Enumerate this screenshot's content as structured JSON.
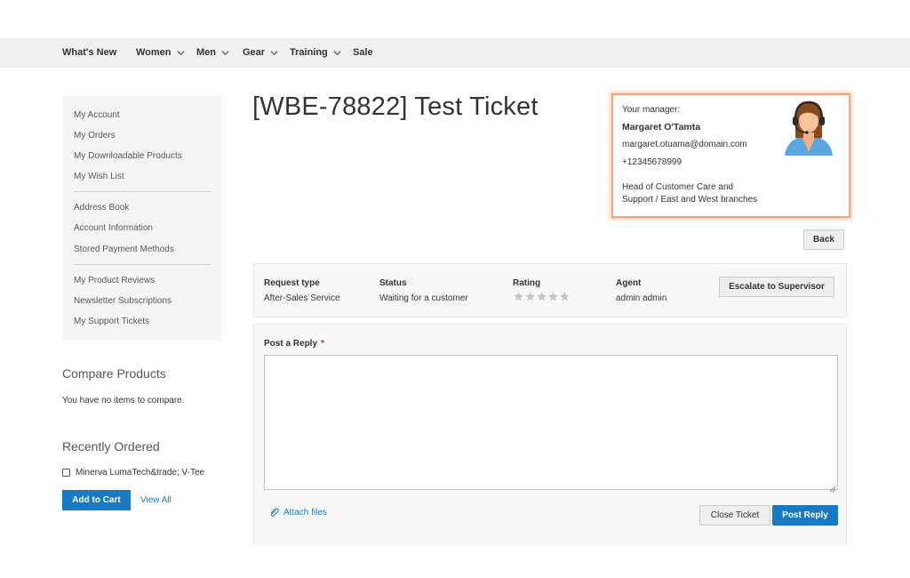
{
  "nav": {
    "items": [
      {
        "label": "What's New",
        "has_menu": false
      },
      {
        "label": "Women",
        "has_menu": true
      },
      {
        "label": "Men",
        "has_menu": true
      },
      {
        "label": "Gear",
        "has_menu": true
      },
      {
        "label": "Training",
        "has_menu": true
      },
      {
        "label": "Sale",
        "has_menu": false
      }
    ]
  },
  "sidebar": {
    "group1": [
      "My Account",
      "My Orders",
      "My Downloadable Products",
      "My Wish List"
    ],
    "group2": [
      "Address Book",
      "Account Information",
      "Stored Payment Methods"
    ],
    "group3": [
      "My Product Reviews",
      "Newsletter Subscriptions",
      "My Support Tickets"
    ]
  },
  "compare": {
    "title": "Compare Products",
    "empty_text": "You have no items to compare."
  },
  "recent": {
    "title": "Recently Ordered",
    "item": "Minerva LumaTech&trade; V-Tee",
    "add_to_cart": "Add to Cart",
    "view_all": "View All"
  },
  "ticket": {
    "title": "[WBE-78822] Test Ticket",
    "back_label": "Back",
    "request_type_label": "Request type",
    "request_type_value": "After-Sales Service",
    "status_label": "Status",
    "status_value": "Waiting for a customer",
    "rating_label": "Rating",
    "rating_value": 0,
    "rating_max": 5,
    "agent_label": "Agent",
    "agent_value": "admin admin",
    "escalate_label": "Escalate to Supervisor"
  },
  "manager": {
    "heading": "Your manager:",
    "name": "Margaret O'Tamta",
    "email": "margaret.otuama@domain.com",
    "phone": "+12345678999",
    "position_line1": "Head of Customer Care and",
    "position_line2": "Support / East and West branches",
    "avatar_icon": "support-agent-avatar-icon"
  },
  "reply": {
    "label": "Post a Reply",
    "required_mark": "*",
    "value": "",
    "attach_label": "Attach files",
    "close_label": "Close Ticket",
    "post_label": "Post Reply"
  },
  "colors": {
    "accent": "#1979c3",
    "highlight_border": "#f5a37a",
    "nav_bg": "#f0f0f0",
    "required": "#e02b27"
  }
}
